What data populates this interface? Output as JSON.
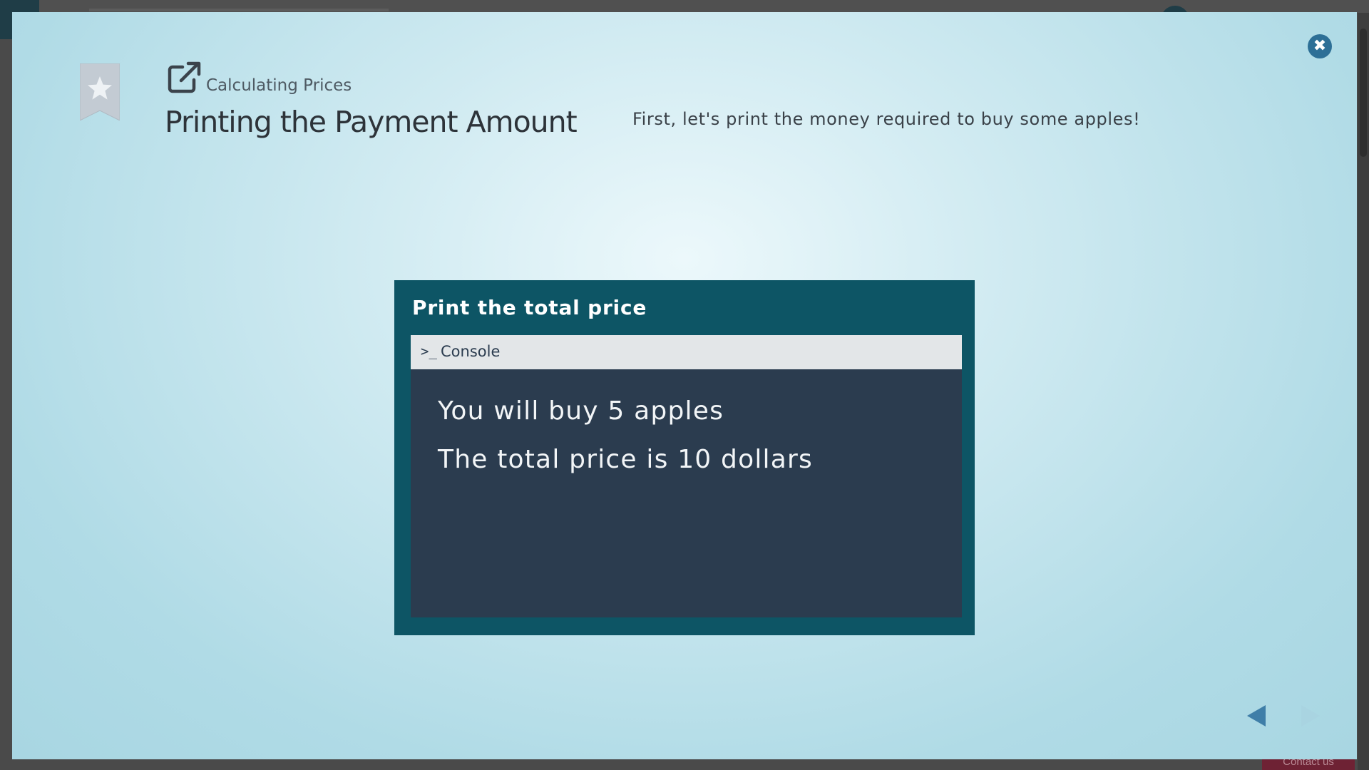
{
  "background": {
    "contact_label": "Contact us"
  },
  "modal": {
    "close_icon": "close-icon",
    "bookmark_icon": "star-bookmark-icon",
    "external_link_icon": "external-link-icon",
    "breadcrumb": "Calculating Prices",
    "title": "Printing the Payment Amount",
    "intro": "First, let's print the money required to buy some apples!"
  },
  "exercise": {
    "title": "Print the total price",
    "console": {
      "prompt_icon": ">_",
      "label": "Console",
      "output": [
        "You will buy 5 apples",
        "The total price is 10 dollars"
      ]
    }
  },
  "navigation": {
    "prev_icon": "triangle-left-icon",
    "next_icon": "triangle-right-icon"
  },
  "colors": {
    "modal_gradient_center": "#ecf8fb",
    "modal_gradient_edge": "#a8d6e2",
    "exercise_frame": "#0d5565",
    "console_body": "#2b3c4f",
    "console_header": "#e3e6e8",
    "close_button": "#2d6f96",
    "nav_prev_active": "#3f7ea8",
    "nav_next_disabled": "#a9d4e1"
  }
}
